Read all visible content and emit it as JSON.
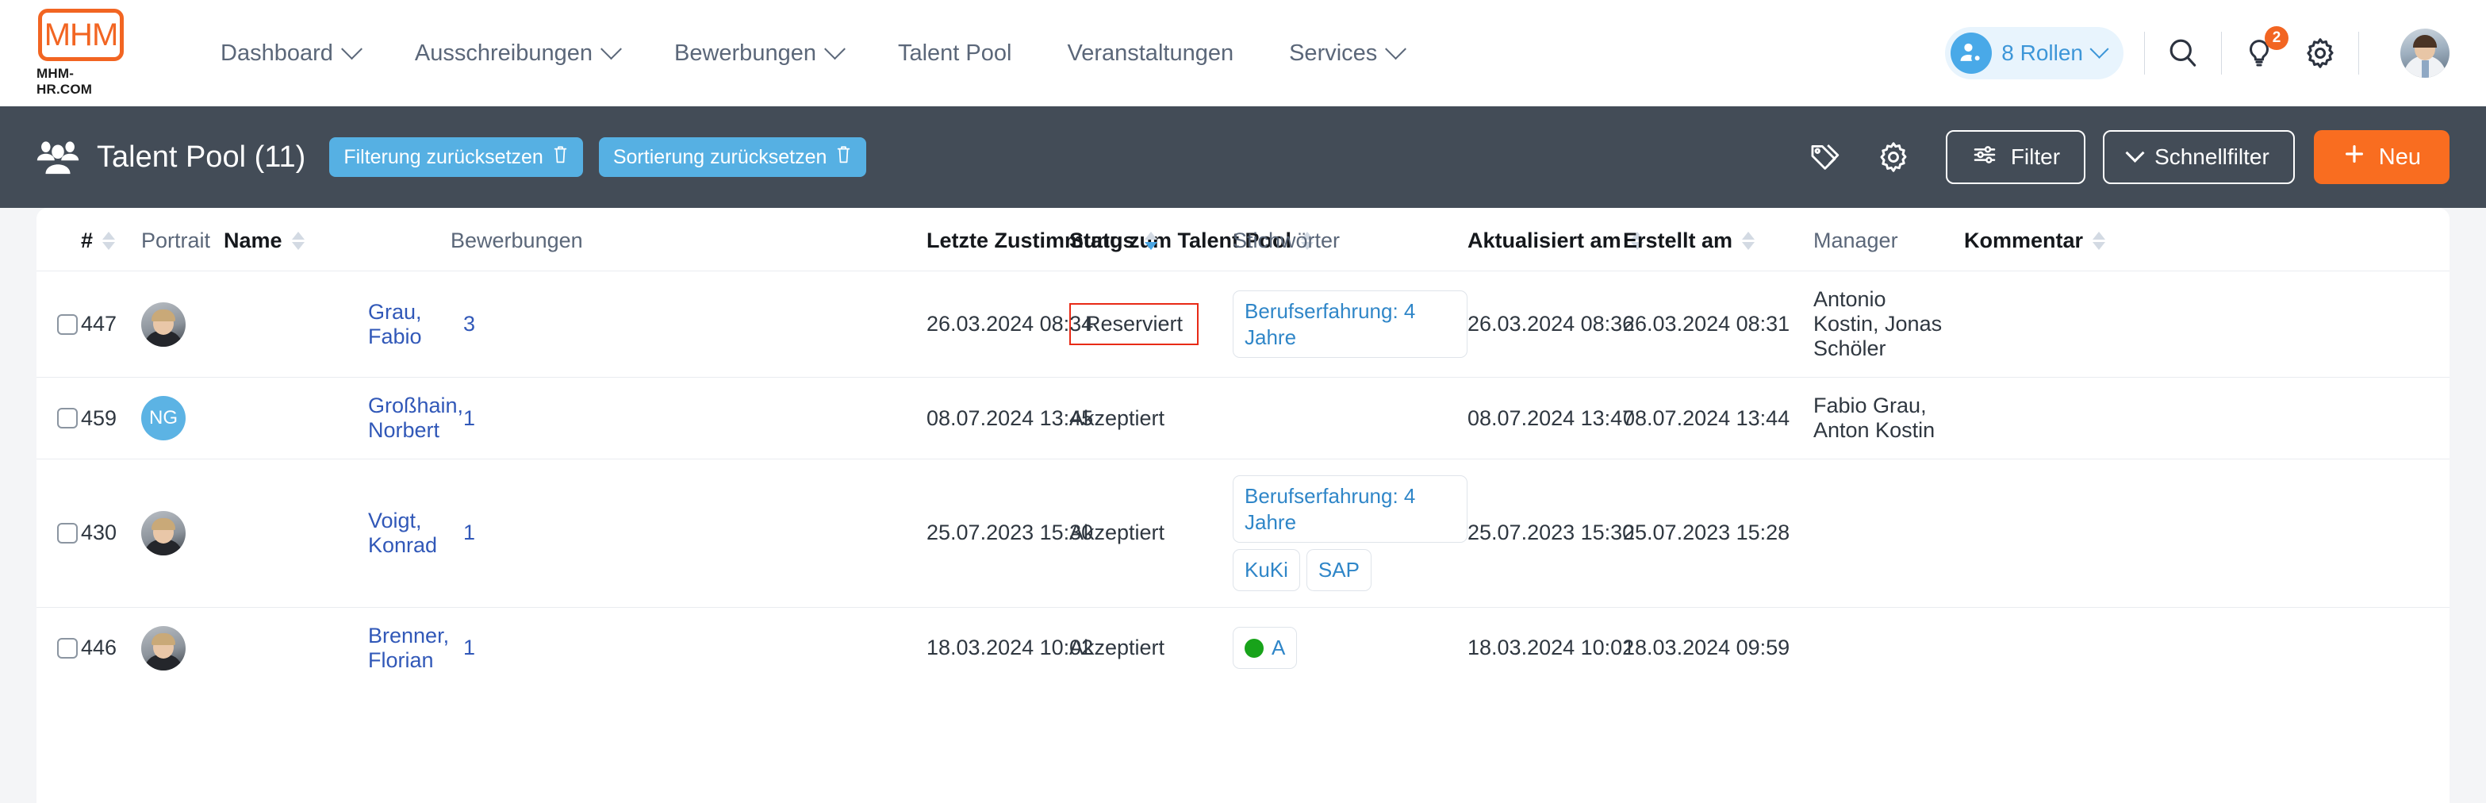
{
  "brand": {
    "logo_letters": "MHM",
    "logo_subtitle": "MHM-HR.COM"
  },
  "topnav": {
    "items": [
      {
        "label": "Dashboard",
        "has_chevron": true
      },
      {
        "label": "Ausschreibungen",
        "has_chevron": true
      },
      {
        "label": "Bewerbungen",
        "has_chevron": true
      },
      {
        "label": "Talent Pool",
        "has_chevron": false
      },
      {
        "label": "Veranstaltungen",
        "has_chevron": false
      },
      {
        "label": "Services",
        "has_chevron": true
      }
    ],
    "roles_pill": {
      "label": "8 Rollen",
      "icon": "user-cog-icon"
    },
    "search_icon": "search-icon",
    "ideas_icon": "lightbulb-icon",
    "ideas_badge": "2",
    "settings_icon": "gear-icon",
    "avatar": "user-avatar"
  },
  "pageheader": {
    "icon": "people-group-icon",
    "title": "Talent Pool (11)",
    "reset_filter": {
      "label": "Filterung zurücksetzen",
      "icon": "trash-icon"
    },
    "reset_sort": {
      "label": "Sortierung zurücksetzen",
      "icon": "trash-icon"
    },
    "tag_icon": "tag-icon",
    "gear_icon": "gear-icon",
    "filter_button": {
      "label": "Filter",
      "icon": "sliders-icon"
    },
    "quickfilter_button": {
      "label": "Schnellfilter",
      "icon": "chevron-down-icon"
    },
    "new_button": {
      "label": "Neu",
      "icon": "plus-icon"
    },
    "accent_color": "#f96d20",
    "bar_color": "#434c57",
    "pill_color": "#56b0e3"
  },
  "table": {
    "columns": [
      {
        "label": "#",
        "sortable": true,
        "strong": true,
        "active_sort": false
      },
      {
        "label": "Portrait",
        "sortable": false,
        "strong": false,
        "active_sort": false
      },
      {
        "label": "Name",
        "sortable": true,
        "strong": true,
        "active_sort": false
      },
      {
        "label": "Bewerbungen",
        "sortable": false,
        "strong": false,
        "active_sort": false
      },
      {
        "label": "Letzte Zustimmung zum Talent Pool",
        "sortable": true,
        "strong": true,
        "active_sort": false
      },
      {
        "label": "Status",
        "sortable": true,
        "strong": true,
        "active_sort": true
      },
      {
        "label": "Stichwörter",
        "sortable": false,
        "strong": false,
        "active_sort": false
      },
      {
        "label": "Aktualisiert am",
        "sortable": true,
        "strong": true,
        "active_sort": false
      },
      {
        "label": "Erstellt am",
        "sortable": true,
        "strong": true,
        "active_sort": false
      },
      {
        "label": "Manager",
        "sortable": true,
        "strong": false,
        "active_sort": false
      },
      {
        "label": "Kommentar",
        "sortable": true,
        "strong": true,
        "active_sort": false
      }
    ],
    "rows": [
      {
        "id": "447",
        "avatar_type": "photo",
        "avatar_initials": "",
        "name": "Grau, Fabio",
        "applications": "3",
        "last_consent": "26.03.2024 08:34",
        "status": "Reserviert",
        "status_highlight": true,
        "keywords": [
          {
            "text": "Berufserfahrung: 4 Jahre",
            "full": true,
            "dot": false
          }
        ],
        "updated_at": "26.03.2024 08:36",
        "created_at": "26.03.2024 08:31",
        "manager": "Antonio Kostin, Jonas Schöler",
        "comment": ""
      },
      {
        "id": "459",
        "avatar_type": "initials",
        "avatar_initials": "NG",
        "name": "Großhain, Norbert",
        "applications": "1",
        "last_consent": "08.07.2024 13:45",
        "status": "Akzeptiert",
        "status_highlight": false,
        "keywords": [],
        "updated_at": "08.07.2024 13:47",
        "created_at": "08.07.2024 13:44",
        "manager": "Fabio Grau, Anton Kostin",
        "comment": ""
      },
      {
        "id": "430",
        "avatar_type": "photo",
        "avatar_initials": "",
        "name": "Voigt, Konrad",
        "applications": "1",
        "last_consent": "25.07.2023 15:30",
        "status": "Akzeptiert",
        "status_highlight": false,
        "keywords": [
          {
            "text": "Berufserfahrung: 4 Jahre",
            "full": true,
            "dot": false
          },
          {
            "text": "KuKi",
            "full": false,
            "dot": false
          },
          {
            "text": "SAP",
            "full": false,
            "dot": false
          }
        ],
        "updated_at": "25.07.2023 15:30",
        "created_at": "25.07.2023 15:28",
        "manager": "",
        "comment": ""
      },
      {
        "id": "446",
        "avatar_type": "photo",
        "avatar_initials": "",
        "name": "Brenner, Florian",
        "applications": "1",
        "last_consent": "18.03.2024 10:02",
        "status": "Akzeptiert",
        "status_highlight": false,
        "keywords": [
          {
            "text": "A",
            "full": false,
            "dot": true
          }
        ],
        "updated_at": "18.03.2024 10:02",
        "created_at": "18.03.2024 09:59",
        "manager": "",
        "comment": ""
      }
    ]
  }
}
